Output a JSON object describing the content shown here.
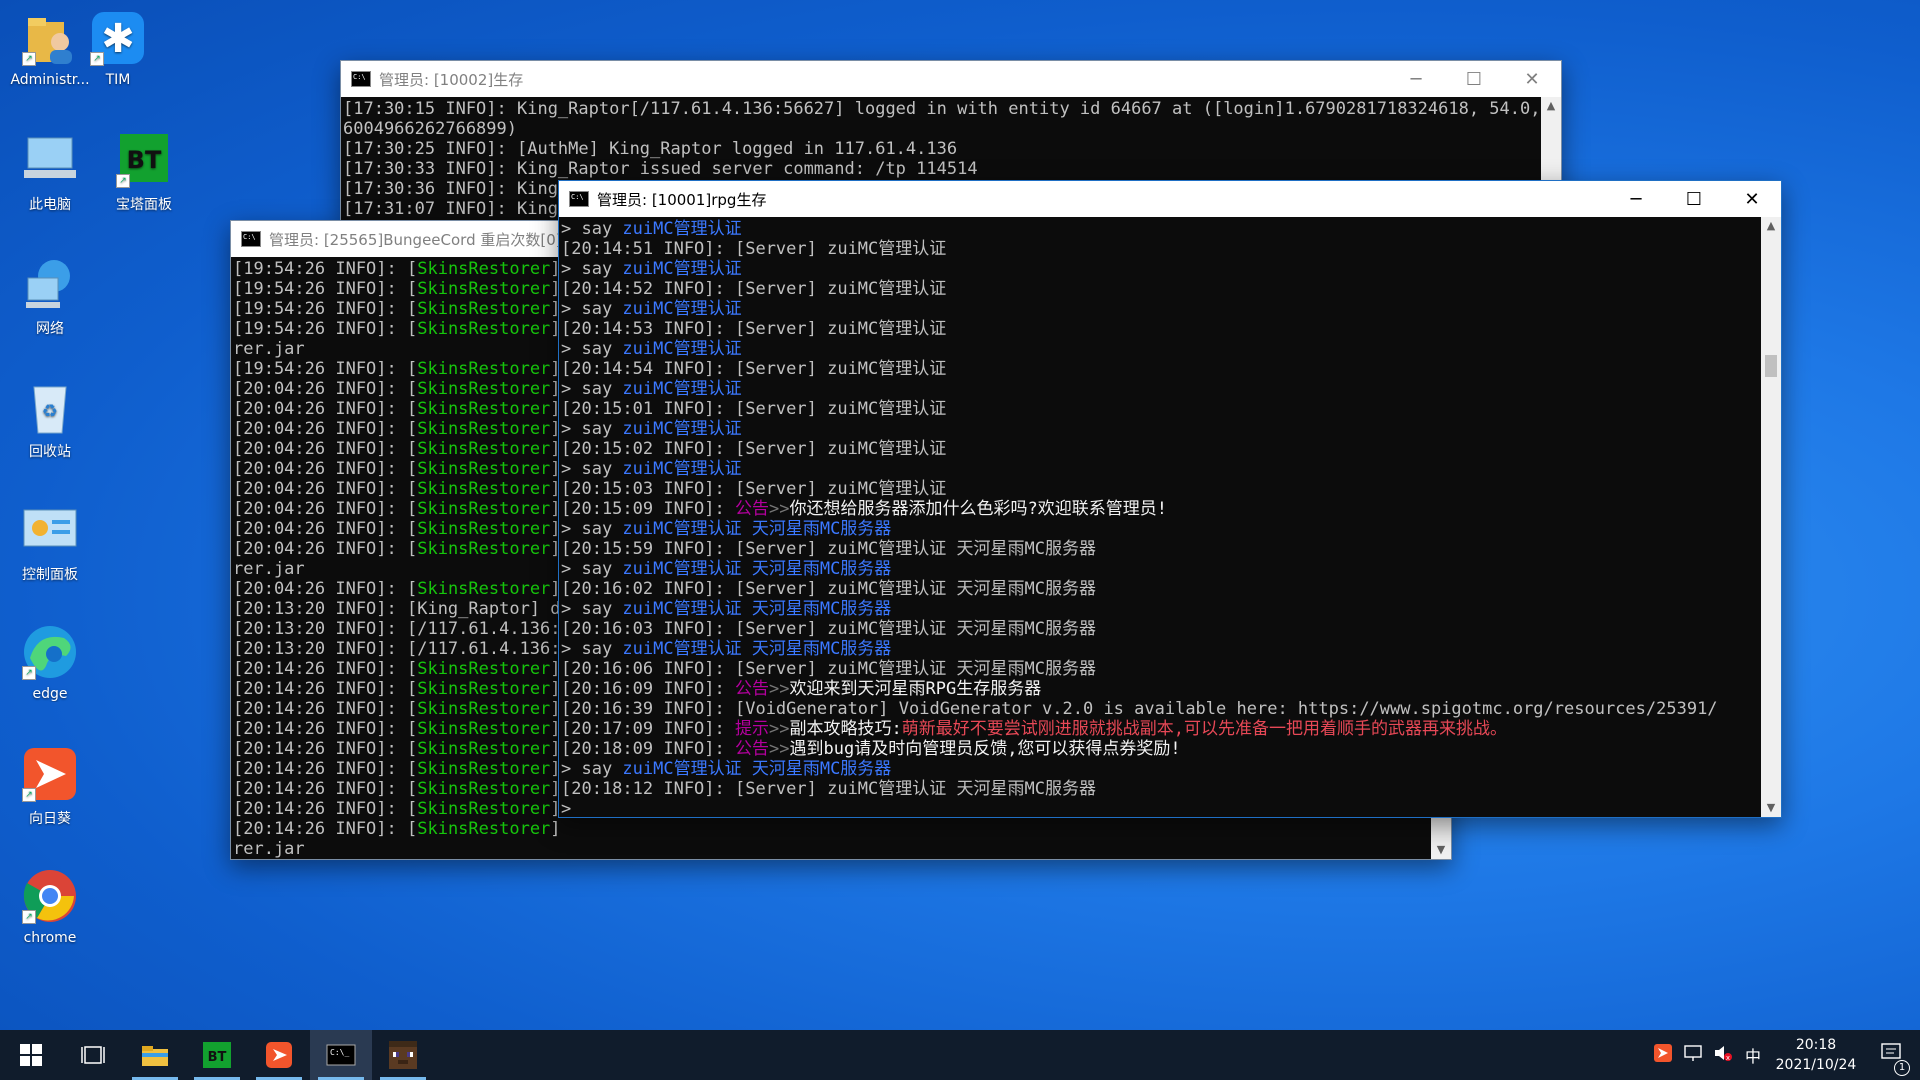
{
  "desktop": {
    "icons": [
      {
        "label": "Administr..."
      },
      {
        "label": "TIM"
      },
      {
        "label": "此电脑"
      },
      {
        "label": "宝塔面板",
        "badge": "BT"
      },
      {
        "label": "网络"
      },
      {
        "label": "回收站"
      },
      {
        "label": "控制面板"
      },
      {
        "label": "edge"
      },
      {
        "label": "向日葵"
      },
      {
        "label": "chrome"
      }
    ]
  },
  "windows": {
    "back": {
      "title": "管理员: [10002]生存",
      "lines": [
        [
          {
            "t": "[17:30:15 INFO]: King_Raptor[/117.61.4.136:56627] logged in with entity id 64667 at ([login]1.6790281718324618, 54.0, 0."
          }
        ],
        [
          {
            "t": "6004966262766899)"
          }
        ],
        [
          {
            "t": "[17:30:25 INFO]: [AuthMe] King_Raptor logged in 117.61.4.136"
          }
        ],
        [
          {
            "t": "[17:30:33 INFO]: King_Raptor issued server command: /tp 114514"
          }
        ],
        [
          {
            "t": "[17:30:36 INFO]: King_"
          }
        ],
        [
          {
            "t": "[17:31:07 INFO]: King_"
          }
        ]
      ]
    },
    "bungee": {
      "title": "管理员: [25565]BungeeCord 重启次数[0]",
      "lines": [
        [
          {
            "t": "[19:54:26 INFO]: ["
          },
          {
            "t": "SkinsRestorer",
            "c": "g"
          },
          {
            "t": "]"
          }
        ],
        [
          {
            "t": "[19:54:26 INFO]: ["
          },
          {
            "t": "SkinsRestorer",
            "c": "g"
          },
          {
            "t": "]"
          }
        ],
        [
          {
            "t": "[19:54:26 INFO]: ["
          },
          {
            "t": "SkinsRestorer",
            "c": "g"
          },
          {
            "t": "]"
          }
        ],
        [
          {
            "t": "[19:54:26 INFO]: ["
          },
          {
            "t": "SkinsRestorer",
            "c": "g"
          },
          {
            "t": "]"
          }
        ],
        [
          {
            "t": "rer.jar"
          }
        ],
        [
          {
            "t": "[19:54:26 INFO]: ["
          },
          {
            "t": "SkinsRestorer",
            "c": "g"
          },
          {
            "t": "]"
          }
        ],
        [
          {
            "t": "[20:04:26 INFO]: ["
          },
          {
            "t": "SkinsRestorer",
            "c": "g"
          },
          {
            "t": "]"
          }
        ],
        [
          {
            "t": "[20:04:26 INFO]: ["
          },
          {
            "t": "SkinsRestorer",
            "c": "g"
          },
          {
            "t": "]"
          }
        ],
        [
          {
            "t": "[20:04:26 INFO]: ["
          },
          {
            "t": "SkinsRestorer",
            "c": "g"
          },
          {
            "t": "]"
          }
        ],
        [
          {
            "t": "[20:04:26 INFO]: ["
          },
          {
            "t": "SkinsRestorer",
            "c": "g"
          },
          {
            "t": "]"
          }
        ],
        [
          {
            "t": "[20:04:26 INFO]: ["
          },
          {
            "t": "SkinsRestorer",
            "c": "g"
          },
          {
            "t": "]"
          }
        ],
        [
          {
            "t": "[20:04:26 INFO]: ["
          },
          {
            "t": "SkinsRestorer",
            "c": "g"
          },
          {
            "t": "]"
          }
        ],
        [
          {
            "t": "[20:04:26 INFO]: ["
          },
          {
            "t": "SkinsRestorer",
            "c": "g"
          },
          {
            "t": "]"
          }
        ],
        [
          {
            "t": "[20:04:26 INFO]: ["
          },
          {
            "t": "SkinsRestorer",
            "c": "g"
          },
          {
            "t": "]"
          }
        ],
        [
          {
            "t": "[20:04:26 INFO]: ["
          },
          {
            "t": "SkinsRestorer",
            "c": "g"
          },
          {
            "t": "]"
          }
        ],
        [
          {
            "t": "rer.jar"
          }
        ],
        [
          {
            "t": "[20:04:26 INFO]: ["
          },
          {
            "t": "SkinsRestorer",
            "c": "g"
          },
          {
            "t": "]"
          }
        ],
        [
          {
            "t": "[20:13:20 INFO]: [King_Raptor] di"
          }
        ],
        [
          {
            "t": "[20:13:20 INFO]: [/117.61.4.136:3"
          }
        ],
        [
          {
            "t": "[20:13:20 INFO]: [/117.61.4.136:3"
          }
        ],
        [
          {
            "t": "[20:14:26 INFO]: ["
          },
          {
            "t": "SkinsRestorer",
            "c": "g"
          },
          {
            "t": "]"
          }
        ],
        [
          {
            "t": "[20:14:26 INFO]: ["
          },
          {
            "t": "SkinsRestorer",
            "c": "g"
          },
          {
            "t": "]"
          }
        ],
        [
          {
            "t": "[20:14:26 INFO]: ["
          },
          {
            "t": "SkinsRestorer",
            "c": "g"
          },
          {
            "t": "]"
          }
        ],
        [
          {
            "t": "[20:14:26 INFO]: ["
          },
          {
            "t": "SkinsRestorer",
            "c": "g"
          },
          {
            "t": "]"
          }
        ],
        [
          {
            "t": "[20:14:26 INFO]: ["
          },
          {
            "t": "SkinsRestorer",
            "c": "g"
          },
          {
            "t": "]"
          }
        ],
        [
          {
            "t": "[20:14:26 INFO]: ["
          },
          {
            "t": "SkinsRestorer",
            "c": "g"
          },
          {
            "t": "]"
          }
        ],
        [
          {
            "t": "[20:14:26 INFO]: ["
          },
          {
            "t": "SkinsRestorer",
            "c": "g"
          },
          {
            "t": "]"
          }
        ],
        [
          {
            "t": "[20:14:26 INFO]: ["
          },
          {
            "t": "SkinsRestorer",
            "c": "g"
          },
          {
            "t": "]"
          }
        ],
        [
          {
            "t": "[20:14:26 INFO]: ["
          },
          {
            "t": "SkinsRestorer",
            "c": "g"
          },
          {
            "t": "]"
          }
        ],
        [
          {
            "t": "rer.jar"
          }
        ],
        [
          {
            "t": "[20:14:26 INFO]: ["
          },
          {
            "t": "SkinsRestorer",
            "c": "g"
          },
          {
            "t": "] "
          },
          {
            "t": "--------------------------------------------",
            "c": "g"
          }
        ],
        [
          {
            "t": ">"
          }
        ]
      ]
    },
    "rpg": {
      "title": "管理员: [10001]rpg生存",
      "lines": [
        [
          {
            "t": "> say "
          },
          {
            "t": "zuiMC管理认证",
            "c": "b"
          }
        ],
        [
          {
            "t": "[20:14:51 INFO]: [Server] zuiMC管理认证"
          }
        ],
        [
          {
            "t": "> say "
          },
          {
            "t": "zuiMC管理认证",
            "c": "b"
          }
        ],
        [
          {
            "t": "[20:14:52 INFO]: [Server] zuiMC管理认证"
          }
        ],
        [
          {
            "t": "> say "
          },
          {
            "t": "zuiMC管理认证",
            "c": "b"
          }
        ],
        [
          {
            "t": "[20:14:53 INFO]: [Server] zuiMC管理认证"
          }
        ],
        [
          {
            "t": "> say "
          },
          {
            "t": "zuiMC管理认证",
            "c": "b"
          }
        ],
        [
          {
            "t": "[20:14:54 INFO]: [Server] zuiMC管理认证"
          }
        ],
        [
          {
            "t": "> say "
          },
          {
            "t": "zuiMC管理认证",
            "c": "b"
          }
        ],
        [
          {
            "t": "[20:15:01 INFO]: [Server] zuiMC管理认证"
          }
        ],
        [
          {
            "t": "> say "
          },
          {
            "t": "zuiMC管理认证",
            "c": "b"
          }
        ],
        [
          {
            "t": "[20:15:02 INFO]: [Server] zuiMC管理认证"
          }
        ],
        [
          {
            "t": "> say "
          },
          {
            "t": "zuiMC管理认证",
            "c": "b"
          }
        ],
        [
          {
            "t": "[20:15:03 INFO]: [Server] zuiMC管理认证"
          }
        ],
        [
          {
            "t": "[20:15:09 INFO]: "
          },
          {
            "t": "公告",
            "c": "m"
          },
          {
            "t": ">>",
            "c": "d"
          },
          {
            "t": "你还想给服务器添加什么色彩吗?欢迎联系管理员!",
            "c": "w"
          }
        ],
        [
          {
            "t": "> say "
          },
          {
            "t": "zuiMC管理认证 天河星雨MC服务器",
            "c": "b"
          }
        ],
        [
          {
            "t": "[20:15:59 INFO]: [Server] zuiMC管理认证 天河星雨MC服务器"
          }
        ],
        [
          {
            "t": "> say "
          },
          {
            "t": "zuiMC管理认证 天河星雨MC服务器",
            "c": "b"
          }
        ],
        [
          {
            "t": "[20:16:02 INFO]: [Server] zuiMC管理认证 天河星雨MC服务器"
          }
        ],
        [
          {
            "t": "> say "
          },
          {
            "t": "zuiMC管理认证 天河星雨MC服务器",
            "c": "b"
          }
        ],
        [
          {
            "t": "[20:16:03 INFO]: [Server] zuiMC管理认证 天河星雨MC服务器"
          }
        ],
        [
          {
            "t": "> say "
          },
          {
            "t": "zuiMC管理认证 天河星雨MC服务器",
            "c": "b"
          }
        ],
        [
          {
            "t": "[20:16:06 INFO]: [Server] zuiMC管理认证 天河星雨MC服务器"
          }
        ],
        [
          {
            "t": "[20:16:09 INFO]: "
          },
          {
            "t": "公告",
            "c": "m"
          },
          {
            "t": ">>",
            "c": "d"
          },
          {
            "t": "欢迎来到天河星雨RPG生存服务器",
            "c": "w"
          }
        ],
        [
          {
            "t": "[20:16:39 INFO]: [VoidGenerator] VoidGenerator v.2.0 is available here: https://www.spigotmc.org/resources/25391/"
          }
        ],
        [
          {
            "t": "[20:17:09 INFO]: "
          },
          {
            "t": "提示",
            "c": "m"
          },
          {
            "t": ">>",
            "c": "d"
          },
          {
            "t": "副本攻略技巧:",
            "c": "w"
          },
          {
            "t": "萌新最好不要尝试刚进服就挑战副本,可以先准备一把用着顺手的武器再来挑战。",
            "c": "r"
          }
        ],
        [
          {
            "t": "[20:18:09 INFO]: "
          },
          {
            "t": "公告",
            "c": "m"
          },
          {
            "t": ">>",
            "c": "d"
          },
          {
            "t": "遇到bug请及时向管理员反馈,您可以获得点券奖励!",
            "c": "w"
          }
        ],
        [
          {
            "t": "> say "
          },
          {
            "t": "zuiMC管理认证 天河星雨MC服务器",
            "c": "b"
          }
        ],
        [
          {
            "t": "[20:18:12 INFO]: [Server] zuiMC管理认证 天河星雨MC服务器"
          }
        ],
        [
          {
            "t": "> "
          },
          {
            "t": "_",
            "c": "w"
          }
        ]
      ]
    }
  },
  "taskbar": {
    "tray": {
      "ime": "中",
      "time": "20:18",
      "date": "2021/10/24",
      "notifications": "1"
    }
  }
}
